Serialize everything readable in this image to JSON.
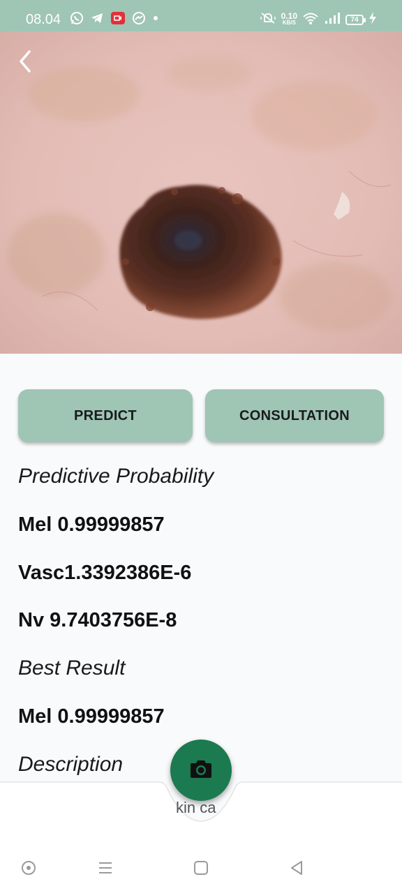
{
  "status_bar": {
    "time": "08.04",
    "net_speed_value": "0.10",
    "net_speed_unit": "KB/S",
    "battery": "74",
    "icons": [
      "whatsapp-icon",
      "telegram-icon",
      "screen-recorder-icon",
      "messenger-icon",
      "dot-icon",
      "mute-icon",
      "wifi-icon",
      "signal-icon",
      "battery-icon",
      "charging-icon"
    ]
  },
  "image": {
    "subject": "skin lesion photo"
  },
  "actions": {
    "predict_label": "PREDICT",
    "consultation_label": "CONSULTATION"
  },
  "results": {
    "probability_heading": "Predictive Probability",
    "items": [
      {
        "label": "Mel 0.99999857"
      },
      {
        "label": "Vasc1.3392386E-6"
      },
      {
        "label": "Nv 9.7403756E-8"
      }
    ],
    "best_heading": "Best Result",
    "best_value": "Mel 0.99999857",
    "description_heading": "Description",
    "description_peek": "kin ca"
  },
  "colors": {
    "status_bar": "#9fc5b5",
    "button": "#9fc5b5",
    "fab": "#1c7a50",
    "background": "#f9fafc"
  }
}
